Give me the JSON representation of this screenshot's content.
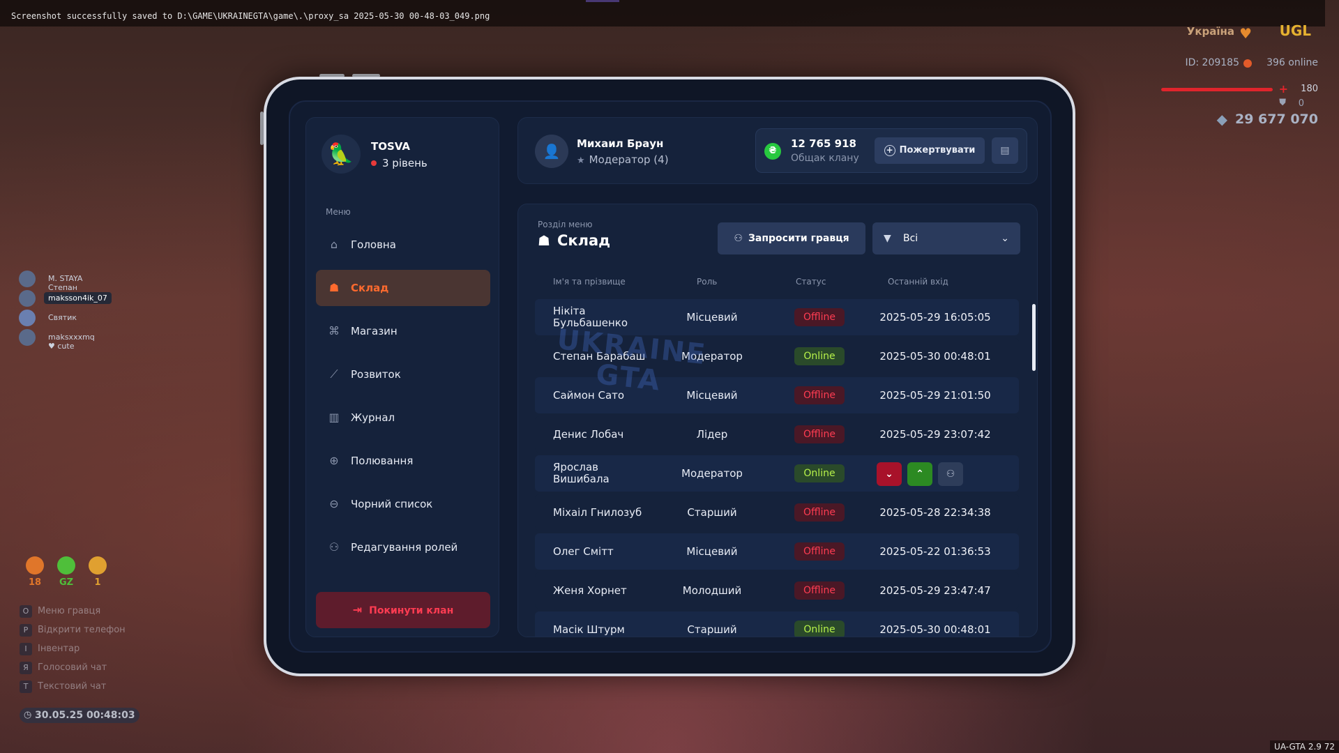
{
  "system": {
    "screenshot_message": "Screenshot successfully saved to D:\\GAME\\UKRAINEGTA\\game\\.\\proxy_sa 2025-05-30 00-48-03_049.png",
    "version": "UA-GTA 2.9   72"
  },
  "hud": {
    "country": "Україна",
    "badge": "UGL",
    "player_id": "ID: 209185",
    "online": "396 online",
    "health": "180",
    "health_fraction": 1.0,
    "armor": "0",
    "money": "29 677 070"
  },
  "voice": [
    {
      "name": "M. STAYA Степан Барабаш",
      "active": false
    },
    {
      "name": "maksson4ik_07",
      "active": true
    },
    {
      "name": "Святик",
      "active": false
    },
    {
      "name": "maksxxxmq",
      "extra": "♥ cute",
      "active": false
    }
  ],
  "stats": [
    {
      "label": "18",
      "color": "#e0762a"
    },
    {
      "label": "GZ",
      "color": "#4fbf3a"
    },
    {
      "label": "1",
      "color": "#e0a030"
    }
  ],
  "hints": [
    {
      "key": "O",
      "text": "Меню гравця"
    },
    {
      "key": "P",
      "text": "Відкрити телефон"
    },
    {
      "key": "I",
      "text": "Інвентар"
    },
    {
      "key": "Я",
      "text": "Голосовий чат"
    },
    {
      "key": "T",
      "text": "Текстовий чат"
    }
  ],
  "clock": "30.05.25 00:48:03",
  "clan": {
    "name": "TOSVA",
    "level": "3 рівень"
  },
  "menu": {
    "title": "Меню",
    "items": [
      {
        "label": "Головна",
        "icon": "home-icon",
        "active": false
      },
      {
        "label": "Склад",
        "icon": "team-icon",
        "active": true
      },
      {
        "label": "Магазин",
        "icon": "shop-icon",
        "active": false
      },
      {
        "label": "Розвиток",
        "icon": "chart-icon",
        "active": false
      },
      {
        "label": "Журнал",
        "icon": "book-icon",
        "active": false
      },
      {
        "label": "Полювання",
        "icon": "crosshair-icon",
        "active": false
      },
      {
        "label": "Чорний список",
        "icon": "block-icon",
        "active": false
      },
      {
        "label": "Редагування ролей",
        "icon": "user-edit-icon",
        "active": false
      }
    ],
    "leave_label": "Покинути клан"
  },
  "user": {
    "name": "Михаил Браун",
    "role": "Модератор (4)"
  },
  "bank": {
    "amount": "12 765 918",
    "label": "Общак клану",
    "donate_label": "Пожертвувати"
  },
  "section": {
    "label": "Розділ меню",
    "title": "Склад",
    "invite_label": "Запросити гравця",
    "filter_value": "Всі"
  },
  "table": {
    "columns": {
      "name": "Ім'я та прізвище",
      "role": "Роль",
      "status": "Статус",
      "last": "Останній вхід"
    },
    "rows": [
      {
        "name": "Нікіта Бульбашенко",
        "role": "Місцевий",
        "status": "Offline",
        "last": "2025-05-29 16:05:05"
      },
      {
        "name": "Степан Барабаш",
        "role": "Модератор",
        "status": "Online",
        "last": "2025-05-30 00:48:01"
      },
      {
        "name": "Саймон Сато",
        "role": "Місцевий",
        "status": "Offline",
        "last": "2025-05-29 21:01:50"
      },
      {
        "name": "Денис Лобач",
        "role": "Лідер",
        "status": "Offline",
        "last": "2025-05-29 23:07:42"
      },
      {
        "name": "Ярослав Вишибала",
        "role": "Модератор",
        "status": "Online",
        "last": "",
        "actions": true
      },
      {
        "name": "Міхаіл Гнилозуб",
        "role": "Старший",
        "status": "Offline",
        "last": "2025-05-28 22:34:38"
      },
      {
        "name": "Олег Смітт",
        "role": "Місцевий",
        "status": "Offline",
        "last": "2025-05-22 01:36:53"
      },
      {
        "name": "Женя Хорнет",
        "role": "Молодший",
        "status": "Offline",
        "last": "2025-05-29 23:47:47"
      },
      {
        "name": "Масік Штурм",
        "role": "Старший",
        "status": "Online",
        "last": "2025-05-30 00:48:01"
      }
    ]
  },
  "watermark": {
    "line1": "UKRAINE",
    "line2": "GTA"
  }
}
